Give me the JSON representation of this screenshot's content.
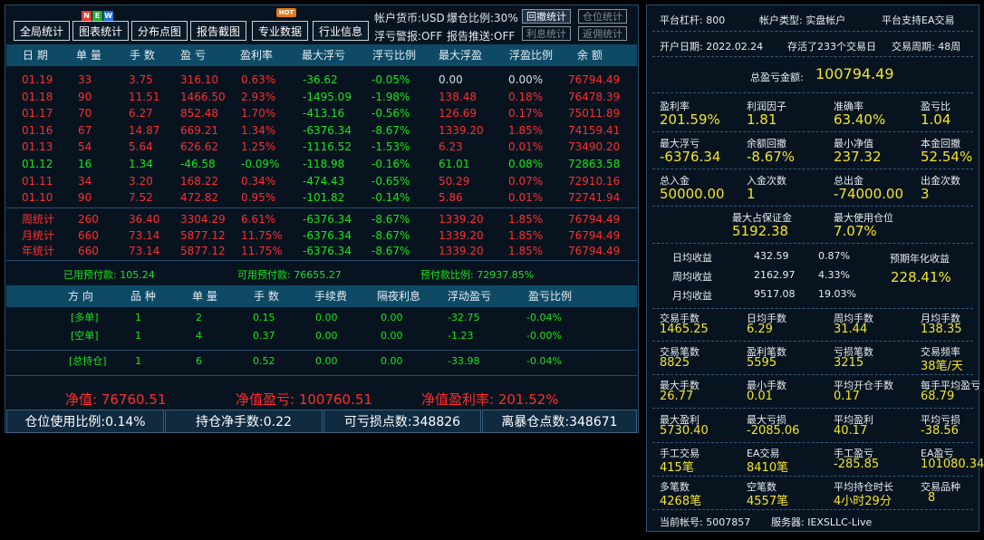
{
  "toolbar": {
    "buttons": [
      "全局统计",
      "图表统计",
      "分布点图",
      "报告截图",
      "专业数据",
      "行业信息"
    ],
    "badge_new": [
      "N",
      "E",
      "W"
    ],
    "badge_hot": "HOT",
    "account_currency": "帐户货币:USD",
    "margin_ratio": "爆仓比例:30%",
    "float_alert": "浮亏警报:OFF",
    "report_push": "报告推送:OFF",
    "side_buttons": [
      "回撤统计",
      "仓位统计",
      "利息统计",
      "返佣统计"
    ]
  },
  "table": {
    "headers": [
      "日 期",
      "单 量",
      "手 数",
      "盈 亏",
      "盈利率",
      "最大浮亏",
      "浮亏比例",
      "最大浮盈",
      "浮盈比例",
      "余 额"
    ],
    "rows": [
      {
        "date": "01.19",
        "orders": "33",
        "lots": "3.75",
        "pnl": "316.10",
        "rate": "0.63%",
        "max_float_loss": "-36.62",
        "float_loss_ratio": "-0.05%",
        "max_float_gain": "0.00",
        "float_gain_ratio": "0.00%",
        "balance": "76794.49",
        "color": "red"
      },
      {
        "date": "01.18",
        "orders": "90",
        "lots": "11.51",
        "pnl": "1466.50",
        "rate": "2.93%",
        "max_float_loss": "-1495.09",
        "float_loss_ratio": "-1.98%",
        "max_float_gain": "138.48",
        "float_gain_ratio": "0.18%",
        "balance": "76478.39",
        "color": "red"
      },
      {
        "date": "01.17",
        "orders": "70",
        "lots": "6.27",
        "pnl": "852.48",
        "rate": "1.70%",
        "max_float_loss": "-413.16",
        "float_loss_ratio": "-0.56%",
        "max_float_gain": "126.69",
        "float_gain_ratio": "0.17%",
        "balance": "75011.89",
        "color": "red"
      },
      {
        "date": "01.16",
        "orders": "67",
        "lots": "14.87",
        "pnl": "669.21",
        "rate": "1.34%",
        "max_float_loss": "-6376.34",
        "float_loss_ratio": "-8.67%",
        "max_float_gain": "1339.20",
        "float_gain_ratio": "1.85%",
        "balance": "74159.41",
        "color": "red"
      },
      {
        "date": "01.13",
        "orders": "54",
        "lots": "5.64",
        "pnl": "626.62",
        "rate": "1.25%",
        "max_float_loss": "-1116.52",
        "float_loss_ratio": "-1.53%",
        "max_float_gain": "6.23",
        "float_gain_ratio": "0.01%",
        "balance": "73490.20",
        "color": "red"
      },
      {
        "date": "01.12",
        "orders": "16",
        "lots": "1.34",
        "pnl": "-46.58",
        "rate": "-0.09%",
        "max_float_loss": "-118.98",
        "float_loss_ratio": "-0.16%",
        "max_float_gain": "61.01",
        "float_gain_ratio": "0.08%",
        "balance": "72863.58",
        "color": "grn"
      },
      {
        "date": "01.11",
        "orders": "34",
        "lots": "3.20",
        "pnl": "168.22",
        "rate": "0.34%",
        "max_float_loss": "-474.43",
        "float_loss_ratio": "-0.65%",
        "max_float_gain": "50.29",
        "float_gain_ratio": "0.07%",
        "balance": "72910.16",
        "color": "red"
      },
      {
        "date": "01.10",
        "orders": "90",
        "lots": "7.52",
        "pnl": "472.82",
        "rate": "0.95%",
        "max_float_loss": "-101.82",
        "float_loss_ratio": "-0.14%",
        "max_float_gain": "5.86",
        "float_gain_ratio": "0.01%",
        "balance": "72741.94",
        "color": "red"
      }
    ],
    "summary": [
      {
        "date": "周统计",
        "orders": "260",
        "lots": "36.40",
        "pnl": "3304.29",
        "rate": "6.61%",
        "max_float_loss": "-6376.34",
        "float_loss_ratio": "-8.67%",
        "max_float_gain": "1339.20",
        "float_gain_ratio": "1.85%",
        "balance": "76794.49"
      },
      {
        "date": "月统计",
        "orders": "660",
        "lots": "73.14",
        "pnl": "5877.12",
        "rate": "11.75%",
        "max_float_loss": "-6376.34",
        "float_loss_ratio": "-8.67%",
        "max_float_gain": "1339.20",
        "float_gain_ratio": "1.85%",
        "balance": "76794.49"
      },
      {
        "date": "年统计",
        "orders": "660",
        "lots": "73.14",
        "pnl": "5877.12",
        "rate": "11.75%",
        "max_float_loss": "-6376.34",
        "float_loss_ratio": "-8.67%",
        "max_float_gain": "1339.20",
        "float_gain_ratio": "1.85%",
        "balance": "76794.49"
      }
    ]
  },
  "margin": {
    "used": "已用预付款: 105.24",
    "available": "可用预付款: 76655.27",
    "ratio": "预付款比例: 72937.85%"
  },
  "positions": {
    "headers": [
      "方 向",
      "品 种",
      "单 量",
      "手 数",
      "手续费",
      "隔夜利息",
      "浮动盈亏",
      "盈亏比例"
    ],
    "rows": [
      [
        "[多单]",
        "1",
        "2",
        "0.15",
        "0.00",
        "0.00",
        "-32.75",
        "-0.04%"
      ],
      [
        "[空单]",
        "1",
        "4",
        "0.37",
        "0.00",
        "0.00",
        "-1.23",
        "-0.00%"
      ]
    ],
    "total": [
      "[总持仓]",
      "1",
      "6",
      "0.52",
      "0.00",
      "0.00",
      "-33.98",
      "-0.04%"
    ]
  },
  "net": {
    "net_value": "净值: 76760.51",
    "net_pnl": "净值盈亏: 100760.51",
    "net_rate": "净值盈利率: 201.52%"
  },
  "footer": [
    "仓位使用比例:0.14%",
    "持仓净手数:0.22",
    "可亏损点数:348826",
    "离暴仓点数:348671"
  ],
  "right": {
    "platform_leverage": "平台杠杆: 800",
    "account_type": "帐户类型: 实盘帐户",
    "ea_support": "平台支持EA交易",
    "open_date": "开户日期: 2022.02.24",
    "live_days": "存活了233个交易日",
    "trade_cycle": "交易周期: 48周",
    "total_profit_label": "总盈亏金额:",
    "total_profit": "100794.49",
    "stats_row1": [
      [
        "盈利率",
        "201.59%"
      ],
      [
        "利润因子",
        "1.81"
      ],
      [
        "准确率",
        "63.40%"
      ],
      [
        "盈亏比",
        "1.04"
      ]
    ],
    "stats_row2": [
      [
        "最大浮亏",
        "-6376.34"
      ],
      [
        "余额回撤",
        "-8.67%"
      ],
      [
        "最小净值",
        "237.32"
      ],
      [
        "本金回撤",
        "52.54%"
      ]
    ],
    "stats_row3": [
      [
        "总入金",
        "50000.00"
      ],
      [
        "入金次数",
        "1"
      ],
      [
        "总出金",
        "-74000.00"
      ],
      [
        "出金次数",
        "3"
      ]
    ],
    "stats_row4": [
      [
        "最大占保证金",
        "5192.38"
      ],
      [
        "最大使用仓位",
        "7.07%"
      ]
    ],
    "avg": [
      {
        "label": "日均收益",
        "value": "432.59",
        "pct": "0.87%"
      },
      {
        "label": "周均收益",
        "value": "2162.97",
        "pct": "4.33%"
      },
      {
        "label": "月均收益",
        "value": "9517.08",
        "pct": "19.03%"
      }
    ],
    "annual_label": "预期年化收益",
    "annual_value": "228.41%",
    "grid": [
      [
        [
          "交易手数",
          "1465.25"
        ],
        [
          "日均手数",
          "6.29"
        ],
        [
          "周均手数",
          "31.44"
        ],
        [
          "月均手数",
          "138.35"
        ]
      ],
      [
        [
          "交易笔数",
          "8825"
        ],
        [
          "盈利笔数",
          "5595"
        ],
        [
          "亏损笔数",
          "3215"
        ],
        [
          "交易频率",
          "38笔/天"
        ]
      ],
      [
        [
          "最大手数",
          "26.77"
        ],
        [
          "最小手数",
          "0.01"
        ],
        [
          "平均开仓手数",
          "0.17"
        ],
        [
          "每手平均盈亏",
          "68.79"
        ]
      ],
      [
        [
          "最大盈利",
          "5730.40"
        ],
        [
          "最大亏损",
          "-2085.06"
        ],
        [
          "平均盈利",
          "40.17"
        ],
        [
          "平均亏损",
          "-38.56"
        ]
      ],
      [
        [
          "手工交易",
          "415笔"
        ],
        [
          "EA交易",
          "8410笔"
        ],
        [
          "手工盈亏",
          "-285.85"
        ],
        [
          "EA盈亏",
          "101080.34"
        ]
      ],
      [
        [
          "多笔数",
          "4268笔"
        ],
        [
          "空笔数",
          "4557笔"
        ],
        [
          "平均持仓时长",
          "4小时29分"
        ],
        [
          "交易品种",
          "8"
        ]
      ]
    ],
    "account_no": "当前帐号: 5007857",
    "server": "服务器: IEXSLLC-Live"
  }
}
